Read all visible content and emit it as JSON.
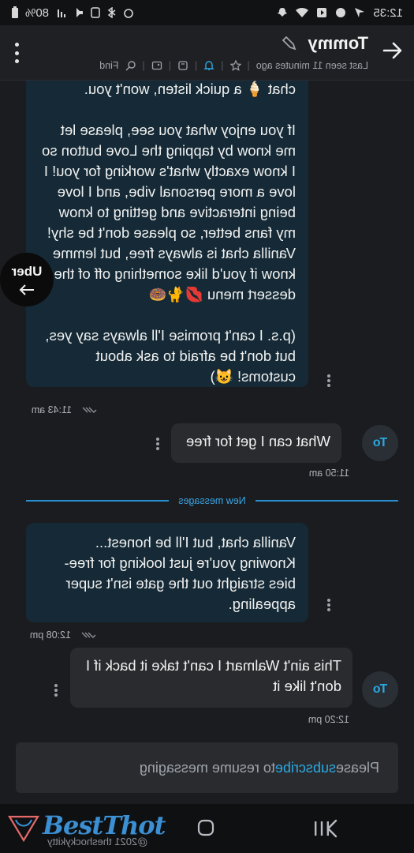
{
  "status_bar": {
    "time": "12:35",
    "battery": "80%"
  },
  "header": {
    "title": "Tommy",
    "last_seen": "Last seen 11 minutes ago",
    "find_label": "Find"
  },
  "messages": [
    {
      "direction": "in",
      "text": "chat 🍦 a quick listen, won't you.\n\nIf you enjoy what you see, please let me know by tapping the Love button so I know exactly what's working for you! I love a more personal vibe, and I love being interactive and getting to know my fans better, so please don't be shy! Vanilla chat is always free, but lemme know if you'd like something off of the dessert menu 💋🐈🍩\n\n(p.s. I can't promise I'll always say yes, but don't be afraid to ask about customs! 😺)",
      "time": "11:43 am"
    },
    {
      "direction": "out",
      "text": "What can I get for free",
      "time": "11:50 am",
      "avatar": "To"
    },
    {
      "direction": "in",
      "text": "Vanilla chat, but I'll be honest... Knowing you're just looking for free-bies straight out the gate isn't super appealing.",
      "time": "12:08 pm"
    },
    {
      "direction": "out",
      "text": "This ain't Walmart I can't take it back if I don't like it",
      "time": "12:20 pm",
      "avatar": "To"
    }
  ],
  "divider": {
    "label": "New messages"
  },
  "floating_app": {
    "label": "Uber"
  },
  "composer": {
    "prefix": "Please ",
    "link": "subscribe",
    "suffix": " to resume messaging"
  },
  "watermark": {
    "logo": "BestThot",
    "credit": "@2021 theshockykitty"
  },
  "colors": {
    "incoming_bubble": "#152a36",
    "outgoing_bubble": "#2a2b2f",
    "accent": "#2aa8e0"
  }
}
